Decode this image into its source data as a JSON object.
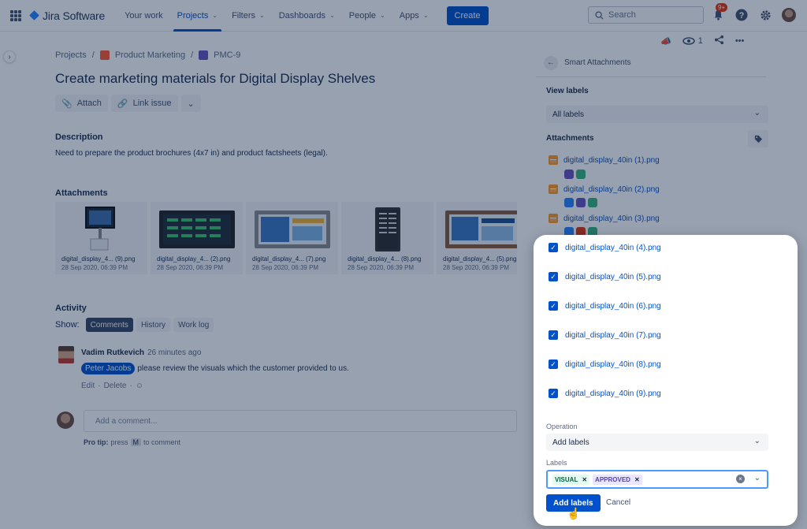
{
  "nav": {
    "logo": "Jira Software",
    "items": [
      {
        "label": "Your work"
      },
      {
        "label": "Projects",
        "active": true
      },
      {
        "label": "Filters"
      },
      {
        "label": "Dashboards"
      },
      {
        "label": "People"
      },
      {
        "label": "Apps"
      }
    ],
    "create": "Create",
    "search_placeholder": "Search",
    "notifications_badge": "9+"
  },
  "breadcrumb": {
    "root": "Projects",
    "project": "Product Marketing",
    "issue_key": "PMC-9"
  },
  "issue": {
    "title": "Create marketing materials for Digital Display Shelves",
    "attach": "Attach",
    "link_issue": "Link issue",
    "description_heading": "Description",
    "description": "Need to prepare the product brochures (4x7 in) and product factsheets (legal).",
    "attachments_heading": "Attachments",
    "thumbnails": [
      {
        "name": "digital_display_4... (9).png",
        "date": "28 Sep 2020, 06:39 PM"
      },
      {
        "name": "digital_display_4... (2).png",
        "date": "28 Sep 2020, 06:39 PM"
      },
      {
        "name": "digital_display_4... (7).png",
        "date": "28 Sep 2020, 06:39 PM"
      },
      {
        "name": "digital_display_4... (8).png",
        "date": "28 Sep 2020, 06:39 PM"
      },
      {
        "name": "digital_display_4... (5).png",
        "date": "28 Sep 2020, 06:39 PM"
      }
    ]
  },
  "activity": {
    "heading": "Activity",
    "show_label": "Show:",
    "tabs": [
      "Comments",
      "History",
      "Work log"
    ],
    "comment": {
      "author": "Vadim Rutkevich",
      "time": "26 minutes ago",
      "mention": "Peter Jacobs",
      "text": "please review the visuals which the customer provided to us.",
      "edit": "Edit",
      "delete": "Delete"
    },
    "add_comment_placeholder": "Add a comment...",
    "protip_prefix": "Pro tip:",
    "protip_press": "press",
    "protip_key": "M",
    "protip_suffix": "to comment"
  },
  "panel": {
    "watchers": "1",
    "title": "Smart Attachments",
    "view_labels": "View labels",
    "view_labels_value": "All labels",
    "attachments_heading": "Attachments",
    "files": [
      {
        "name": "digital_display_40in (1).png",
        "labels": [
          "#6554c0",
          "#36b37e"
        ]
      },
      {
        "name": "digital_display_40in (2).png",
        "labels": [
          "#2684ff",
          "#6554c0",
          "#36b37e"
        ]
      },
      {
        "name": "digital_display_40in (3).png",
        "labels": [
          "#2684ff",
          "#de350b",
          "#36b37e"
        ]
      }
    ]
  },
  "popover": {
    "checked_files": [
      "digital_display_40in (4).png",
      "digital_display_40in (5).png",
      "digital_display_40in (6).png",
      "digital_display_40in (7).png",
      "digital_display_40in (8).png",
      "digital_display_40in (9).png"
    ],
    "operation_label": "Operation",
    "operation_value": "Add labels",
    "labels_label": "Labels",
    "label_tags": [
      "VISUAL",
      "APPROVED"
    ],
    "add_button": "Add labels",
    "cancel": "Cancel"
  },
  "colors": {
    "accent": "#0052cc",
    "overlay": "#091e42"
  }
}
